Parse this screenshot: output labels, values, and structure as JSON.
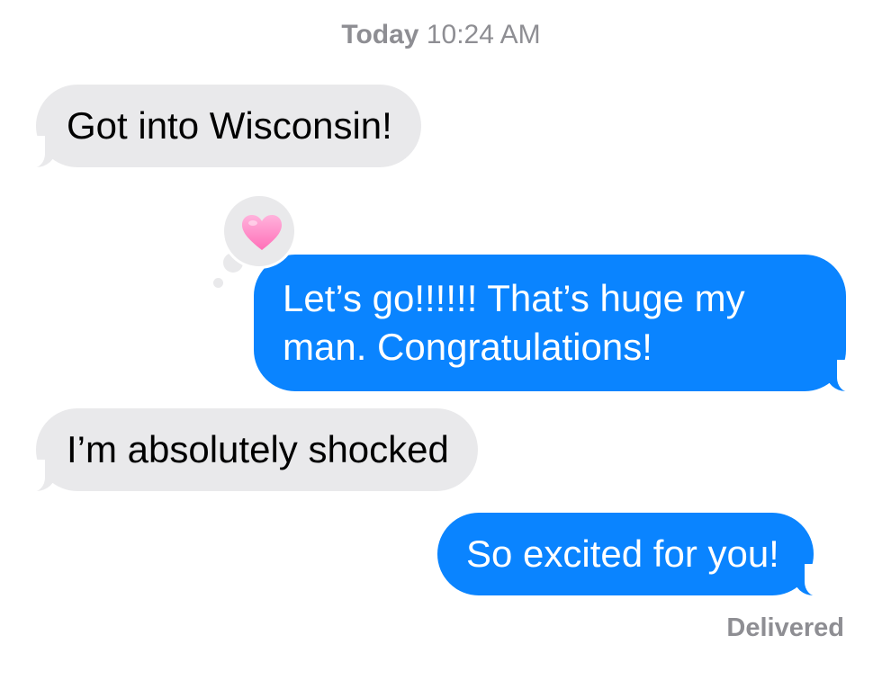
{
  "thread": {
    "timestamp_day": "Today",
    "timestamp_time": "10:24 AM",
    "messages": [
      {
        "direction": "received",
        "text": "Got into Wisconsin!"
      },
      {
        "direction": "sent",
        "text": "Let’s go!!!!!! That’s huge my man. Congratulations!",
        "tapback": "heart-icon"
      },
      {
        "direction": "received",
        "text": "I’m absolutely shocked"
      },
      {
        "direction": "sent",
        "text": "So excited for you!"
      }
    ],
    "status": "Delivered"
  },
  "colors": {
    "sent_bubble": "#0a84ff",
    "received_bubble": "#e9e9eb",
    "meta_text": "#8e8e93",
    "heart": "#ff8fc8"
  }
}
